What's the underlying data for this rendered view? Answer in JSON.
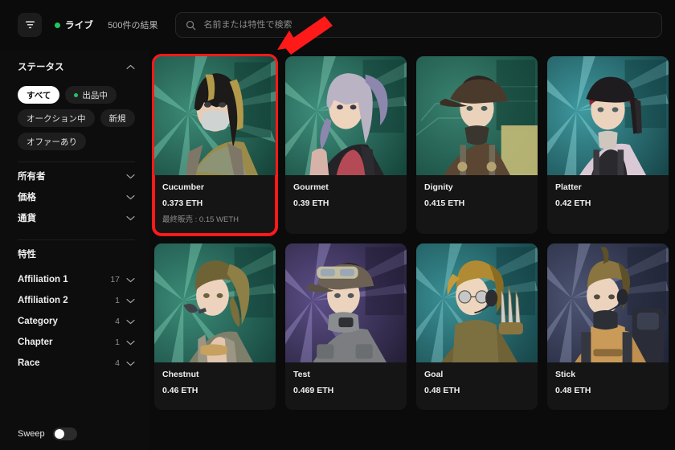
{
  "topbar": {
    "filter_icon": "funnel-icon",
    "live_label": "ライブ",
    "live_dot_color": "#22c55e",
    "results_count": "500件の結果",
    "search_icon": "search-icon",
    "search_value": "",
    "search_placeholder": "名前または特性で検索"
  },
  "sidebar": {
    "status": {
      "title": "ステータス",
      "chips": [
        {
          "label": "すべて",
          "active": true,
          "dot": false
        },
        {
          "label": "出品中",
          "active": false,
          "dot": true
        },
        {
          "label": "オークション中",
          "active": false,
          "dot": false
        },
        {
          "label": "新規",
          "active": false,
          "dot": false
        },
        {
          "label": "オファーあり",
          "active": false,
          "dot": false
        }
      ]
    },
    "collapsed_sections": [
      {
        "label": "所有者",
        "count": ""
      },
      {
        "label": "価格",
        "count": ""
      },
      {
        "label": "通貨",
        "count": ""
      }
    ],
    "traits_title": "特性",
    "traits": [
      {
        "label": "Affiliation 1",
        "count": "17"
      },
      {
        "label": "Affiliation 2",
        "count": "1"
      },
      {
        "label": "Category",
        "count": "4"
      },
      {
        "label": "Chapter",
        "count": "1"
      },
      {
        "label": "Race",
        "count": "4"
      }
    ],
    "sweep": {
      "label": "Sweep",
      "on": false
    }
  },
  "grid": {
    "cards": [
      {
        "name": "Cucumber",
        "price": "0.373 ETH",
        "last_sale": "最終販売 : 0.15 WETH",
        "selected": true,
        "art": {
          "bg1": "#2f6b5e",
          "bg2": "#16463c",
          "ray": "#6fc6ae",
          "hair": "#1d1a1a",
          "hair2": "#b39a4a",
          "skin": "#e8cdb6",
          "outfit": "#9b8b4a",
          "accent": "#cfd4d2"
        }
      },
      {
        "name": "Gourmet",
        "price": "0.39 ETH",
        "last_sale": "",
        "selected": false,
        "art": {
          "bg1": "#2f6b5e",
          "bg2": "#184a40",
          "ray": "#79cdb5",
          "hair": "#b9b3c4",
          "hair2": "#8d86ad",
          "skin": "#efd4bd",
          "outfit": "#242428",
          "accent": "#b44a55"
        }
      },
      {
        "name": "Dignity",
        "price": "0.415 ETH",
        "last_sale": "",
        "selected": false,
        "art": {
          "bg1": "#2c6656",
          "bg2": "#1c4e42",
          "ray": "#5fb79c",
          "hair": "#2b2420",
          "hair2": "#4a3a2c",
          "skin": "#ead2bb",
          "outfit": "#5a4632",
          "accent": "#cfc27a"
        }
      },
      {
        "name": "Platter",
        "price": "0.42 ETH",
        "last_sale": "",
        "selected": false,
        "art": {
          "bg1": "#2f7e82",
          "bg2": "#1a5256",
          "ray": "#86d4da",
          "hair": "#1f1c1f",
          "hair2": "#8e2530",
          "skin": "#ecd3bd",
          "outfit": "#2a2a2e",
          "accent": "#d9c9d5"
        }
      },
      {
        "name": "Chestnut",
        "price": "0.46 ETH",
        "last_sale": "",
        "selected": false,
        "art": {
          "bg1": "#2f6b5e",
          "bg2": "#1a4a40",
          "ray": "#74c8ae",
          "hair": "#6f6336",
          "hair2": "#8d7f45",
          "skin": "#edd3bd",
          "outfit": "#7e7f6a",
          "accent": "#c6a15f"
        }
      },
      {
        "name": "Test",
        "price": "0.469 ETH",
        "last_sale": "",
        "selected": false,
        "art": {
          "bg1": "#4a3f6b",
          "bg2": "#2a2440",
          "ray": "#9a8ec4",
          "hair": "#241f22",
          "hair2": "#6c6152",
          "skin": "#ecd3bd",
          "outfit": "#7b7d80",
          "accent": "#c9c3a4"
        }
      },
      {
        "name": "Goal",
        "price": "0.48 ETH",
        "last_sale": "",
        "selected": false,
        "art": {
          "bg1": "#2f7276",
          "bg2": "#1a4a4e",
          "ray": "#7fcbcf",
          "hair": "#b08b33",
          "hair2": "#8a6b22",
          "skin": "#eed5bd",
          "outfit": "#6e6236",
          "accent": "#cfcfcf"
        }
      },
      {
        "name": "Stick",
        "price": "0.48 ETH",
        "last_sale": "",
        "selected": false,
        "art": {
          "bg1": "#3d4257",
          "bg2": "#23273a",
          "ray": "#8b93b1",
          "hair": "#8a7440",
          "hair2": "#5e5028",
          "skin": "#ecd3bd",
          "outfit": "#c08e4f",
          "accent": "#2a2d38"
        }
      }
    ]
  },
  "annotation": {
    "arrow_color": "#ff1a1a"
  }
}
